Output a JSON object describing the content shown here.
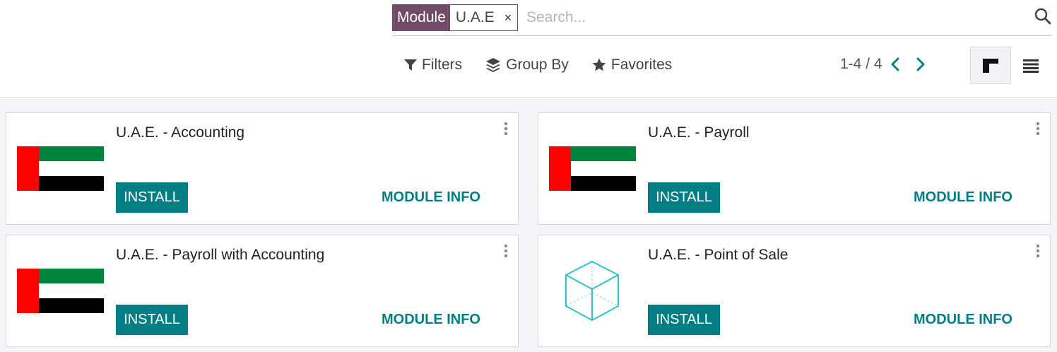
{
  "search": {
    "facet_label": "Module",
    "facet_value": "U.A.E",
    "facet_remove": "×",
    "placeholder": "Search..."
  },
  "toolbar": {
    "filters_label": "Filters",
    "groupby_label": "Group By",
    "favorites_label": "Favorites"
  },
  "pager": {
    "value": "1-4",
    "separator": "/",
    "limit": "4"
  },
  "colors": {
    "brand": "#714b67",
    "accent": "#017e84",
    "flag_green": "#00843d",
    "flag_red": "#ff0000",
    "flag_black": "#000000"
  },
  "cards": [
    {
      "title": "U.A.E. - Accounting",
      "icon": "uae-flag-icon",
      "install_label": "INSTALL",
      "info_label": "MODULE INFO"
    },
    {
      "title": "U.A.E. - Payroll",
      "icon": "uae-flag-icon",
      "install_label": "INSTALL",
      "info_label": "MODULE INFO"
    },
    {
      "title": "U.A.E. - Payroll with Accounting",
      "icon": "uae-flag-icon",
      "install_label": "INSTALL",
      "info_label": "MODULE INFO"
    },
    {
      "title": "U.A.E. - Point of Sale",
      "icon": "cube-icon",
      "install_label": "INSTALL",
      "info_label": "MODULE INFO"
    }
  ]
}
